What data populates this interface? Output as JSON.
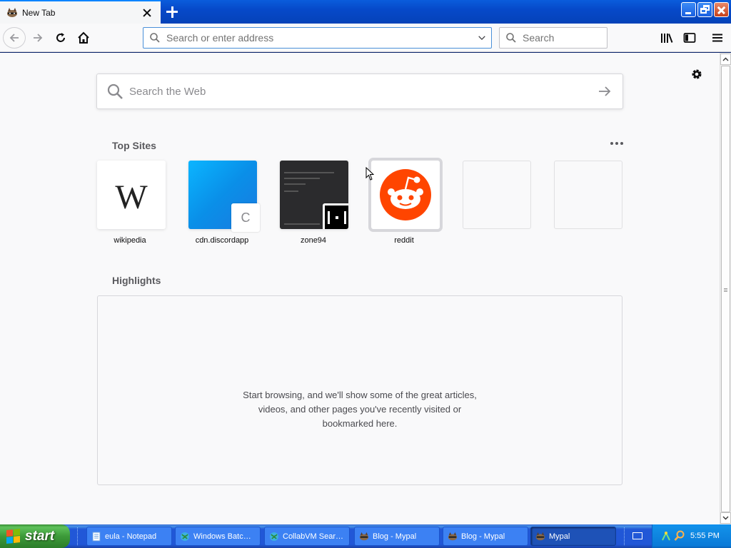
{
  "browser": {
    "tab": {
      "title": "New Tab",
      "favicon": "mypal-raccoon-icon"
    },
    "toolbar": {
      "url_placeholder": "Search or enter address",
      "search_placeholder": "Search"
    }
  },
  "newtab": {
    "web_search_placeholder": "Search the Web",
    "top_sites_title": "Top Sites",
    "top_sites": [
      {
        "label": "wikipedia",
        "logo_text": "W"
      },
      {
        "label": "cdn.discordapp",
        "badge_text": "C"
      },
      {
        "label": "zone94"
      },
      {
        "label": "reddit"
      }
    ],
    "highlights_title": "Highlights",
    "highlights_message": "Start browsing, and we'll show some of the great articles, videos, and other pages you've recently visited or bookmarked here."
  },
  "taskbar": {
    "start_label": "start",
    "tasks": [
      {
        "label": "eula - Notepad",
        "icon": "notepad-icon"
      },
      {
        "label": "Windows Batc…",
        "icon": "globe-icon"
      },
      {
        "label": "CollabVM Sear…",
        "icon": "globe-icon"
      },
      {
        "label": "Blog - Mypal",
        "icon": "mypal-raccoon-icon"
      },
      {
        "label": "Blog - Mypal",
        "icon": "mypal-raccoon-icon"
      },
      {
        "label": "Mypal",
        "icon": "mypal-raccoon-icon"
      }
    ],
    "clock": "5:55 PM"
  },
  "colors": {
    "accent": "#0a84ff",
    "reddit": "#ff4500",
    "xp_taskbar": "#2157d7",
    "xp_start": "#3c9a39"
  }
}
